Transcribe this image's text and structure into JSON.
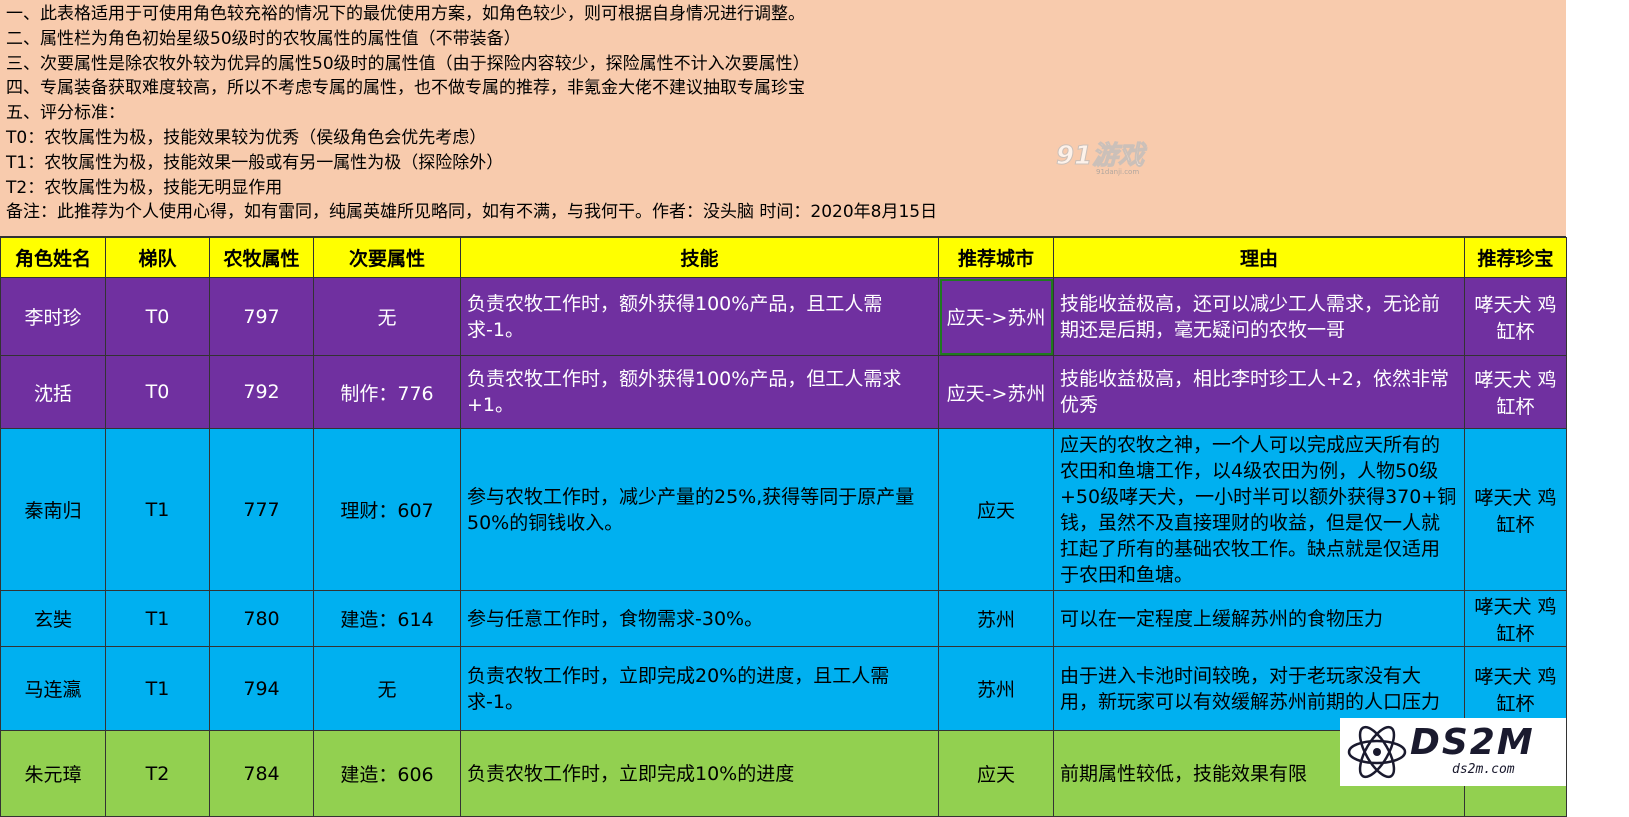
{
  "notes": [
    "一、此表格适用于可使用角色较充裕的情况下的最优使用方案，如角色较少，则可根据自身情况进行调整。",
    "二、属性栏为角色初始星级50级时的农牧属性的属性值（不带装备）",
    "三、次要属性是除农牧外较为优异的属性50级时的属性值（由于探险内容较少，探险属性不计入次要属性）",
    "四、专属装备获取难度较高，所以不考虑专属的属性，也不做专属的推荐，非氪金大佬不建议抽取专属珍宝",
    "五、评分标准：",
    "T0：农牧属性为极，技能效果较为优秀（侯级角色会优先考虑）",
    "T1：农牧属性为极，技能效果一般或有另一属性为极（探险除外）",
    "T2：农牧属性为极，技能无明显作用",
    "备注：此推荐为个人使用心得，如有雷同，纯属英雄所见略同，如有不满，与我何干。作者：没头脑 时间：2020年8月15日"
  ],
  "watermark_91": {
    "main": "91游戏",
    "sub": "91danji.com"
  },
  "headers": [
    "角色姓名",
    "梯队",
    "农牧属性",
    "次要属性",
    "技能",
    "推荐城市",
    "理由",
    "推荐珍宝"
  ],
  "rows": [
    {
      "name": "李时珍",
      "tier": "T0",
      "farm": "797",
      "secondary": "无",
      "skill": "负责农牧工作时，额外获得100%产品，且工人需求-1。",
      "city": "应天->苏州",
      "reason": "技能收益极高，还可以减少工人需求，无论前期还是后期，毫无疑问的农牧一哥",
      "treasure": "哮天犬 鸡缸杯",
      "color": "#7030a0"
    },
    {
      "name": "沈括",
      "tier": "T0",
      "farm": "792",
      "secondary": "制作：776",
      "skill": "负责农牧工作时，额外获得100%产品，但工人需求+1。",
      "city": "应天->苏州",
      "reason": "技能收益极高，相比李时珍工人+2，依然非常优秀",
      "treasure": "哮天犬 鸡缸杯",
      "color": "#7030a0"
    },
    {
      "name": "秦南归",
      "tier": "T1",
      "farm": "777",
      "secondary": "理财：607",
      "skill": "参与农牧工作时，减少产量的25%,获得等同于原产量50%的铜钱收入。",
      "city": "应天",
      "reason": "应天的农牧之神，一个人可以完成应天所有的农田和鱼塘工作，以4级农田为例，人物50级+50级哮天犬，一小时半可以额外获得370+铜钱，虽然不及直接理财的收益，但是仅一人就扛起了所有的基础农牧工作。缺点就是仅适用于农田和鱼塘。",
      "treasure": "哮天犬 鸡缸杯",
      "color": "#00b0f0"
    },
    {
      "name": "玄奘",
      "tier": "T1",
      "farm": "780",
      "secondary": "建造：614",
      "skill": "参与任意工作时，食物需求-30%。",
      "city": "苏州",
      "reason": "可以在一定程度上缓解苏州的食物压力",
      "treasure": "哮天犬 鸡缸杯",
      "color": "#00b0f0"
    },
    {
      "name": "马连瀛",
      "tier": "T1",
      "farm": "794",
      "secondary": "无",
      "skill": "负责农牧工作时，立即完成20%的进度，且工人需求-1。",
      "city": "苏州",
      "reason": "由于进入卡池时间较晚，对于老玩家没有大用，新玩家可以有效缓解苏州前期的人口压力",
      "treasure": "哮天犬 鸡缸杯",
      "color": "#00b0f0"
    },
    {
      "name": "朱元璋",
      "tier": "T2",
      "farm": "784",
      "secondary": "建造：606",
      "skill": "负责农牧工作时，立即完成10%的进度",
      "city": "应天",
      "reason": "前期属性较低，技能效果有限",
      "treasure": "",
      "color": "#92d050"
    }
  ],
  "logo_ds2m": {
    "main": "DS2M",
    "sub": "ds2m.com"
  }
}
